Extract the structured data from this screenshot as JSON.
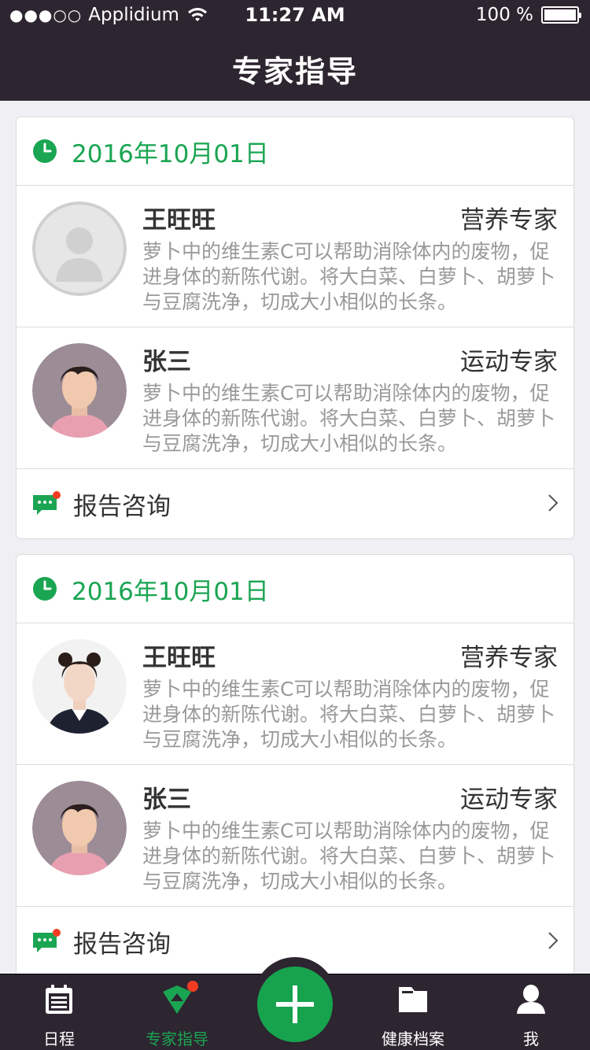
{
  "status_bar": {
    "signal": "●●●○○",
    "carrier": "Applidium",
    "time": "11:27 AM",
    "battery": "100 %"
  },
  "nav": {
    "title": "专家指导"
  },
  "cards": [
    {
      "date": "2016年10月01日",
      "experts": [
        {
          "name": "王旺旺",
          "role": "营养专家",
          "desc": "萝卜中的维生素C可以帮助消除体内的废物，促进身体的新陈代谢。将大白菜、白萝卜、胡萝卜与豆腐洗净，切成大小相似的长条。",
          "avatar": "placeholder"
        },
        {
          "name": "张三",
          "role": "运动专家",
          "desc": "萝卜中的维生素C可以帮助消除体内的废物，促进身体的新陈代谢。将大白菜、白萝卜、胡萝卜与豆腐洗净，切成大小相似的长条。",
          "avatar": "male"
        }
      ],
      "consult_label": "报告咨询"
    },
    {
      "date": "2016年10月01日",
      "experts": [
        {
          "name": "王旺旺",
          "role": "营养专家",
          "desc": "萝卜中的维生素C可以帮助消除体内的废物，促进身体的新陈代谢。将大白菜、白萝卜、胡萝卜与豆腐洗净，切成大小相似的长条。",
          "avatar": "female"
        },
        {
          "name": "张三",
          "role": "运动专家",
          "desc": "萝卜中的维生素C可以帮助消除体内的废物，促进身体的新陈代谢。将大白菜、白萝卜、胡萝卜与豆腐洗净，切成大小相似的长条。",
          "avatar": "male"
        }
      ],
      "consult_label": "报告咨询"
    }
  ],
  "tabbar": {
    "tabs": [
      {
        "label": "日程",
        "icon": "calendar-icon"
      },
      {
        "label": "专家指导",
        "icon": "expert-icon",
        "active": true
      },
      {
        "label": "",
        "icon": "plus-icon"
      },
      {
        "label": "健康档案",
        "icon": "folder-icon"
      },
      {
        "label": "我",
        "icon": "person-icon"
      }
    ]
  },
  "colors": {
    "accent": "#1aa552",
    "header_bg": "#2d2530",
    "badge": "#f23c22"
  }
}
